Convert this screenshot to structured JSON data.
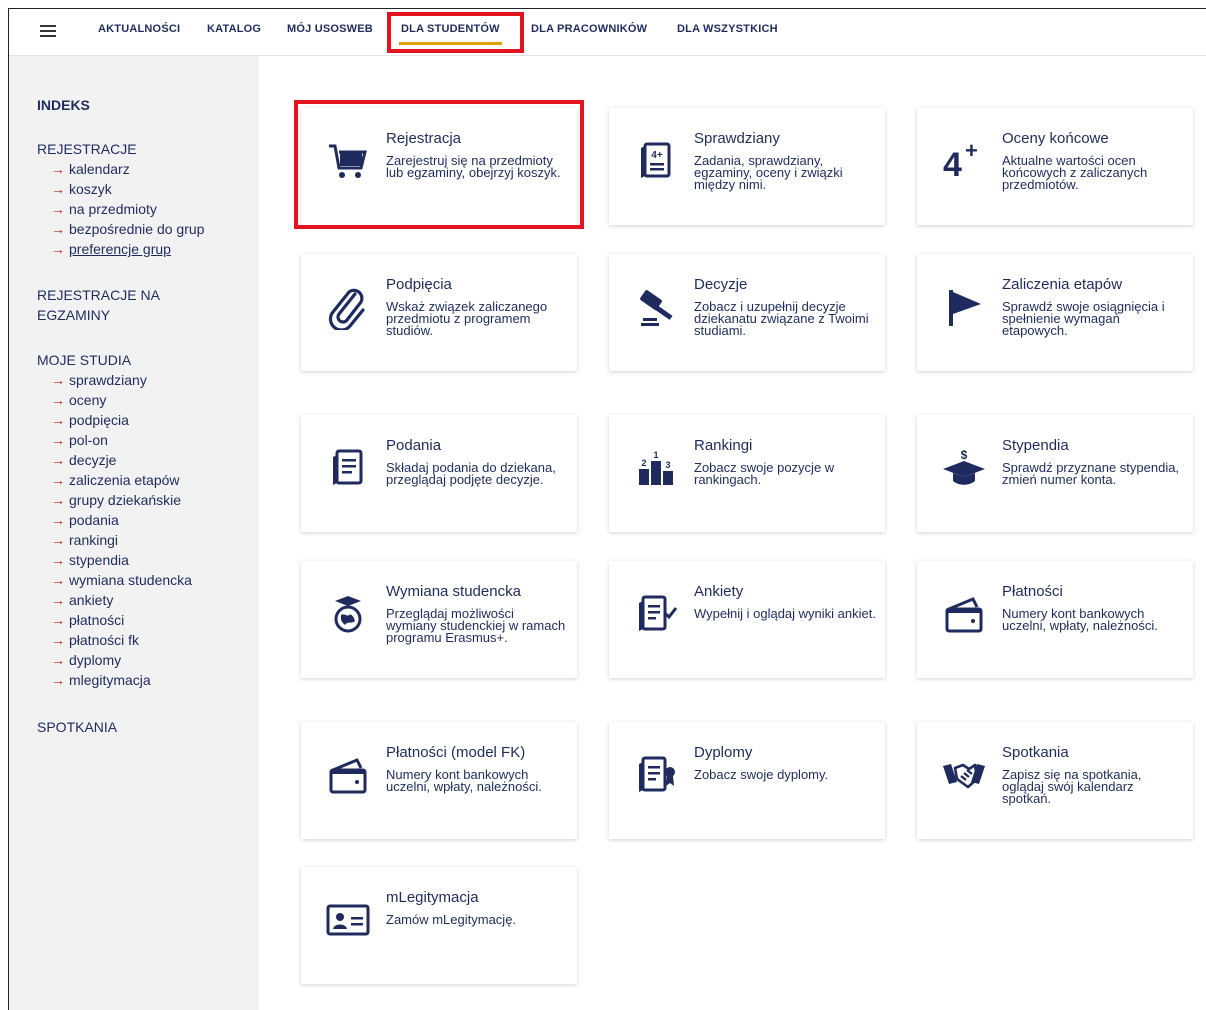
{
  "nav": {
    "items": [
      {
        "label": "AKTUALNOŚCI"
      },
      {
        "label": "KATALOG"
      },
      {
        "label": "MÓJ USOSWEB"
      },
      {
        "label": "DLA STUDENTÓW"
      },
      {
        "label": "DLA PRACOWNIKÓW"
      },
      {
        "label": "DLA WSZYSTKICH"
      }
    ]
  },
  "sidebar": {
    "indeks": "INDEKS",
    "rejestracje": "REJESTRACJE",
    "rejestracje_links": [
      "kalendarz",
      "koszyk",
      "na przedmioty",
      "bezpośrednie do grup",
      "preferencje grup"
    ],
    "rejestracje_na_1": "REJESTRACJE NA",
    "rejestracje_na_2": "EGZAMINY",
    "moje_studia": "MOJE STUDIA",
    "moje_links": [
      "sprawdziany",
      "oceny",
      "podpięcia",
      "pol-on",
      "decyzje",
      "zaliczenia etapów",
      "grupy dziekańskie",
      "podania",
      "rankingi",
      "stypendia",
      "wymiana studencka",
      "ankiety",
      "płatności",
      "płatności fk",
      "dyplomy",
      "mlegitymacja"
    ],
    "spotkania": "SPOTKANIA",
    "arrow": "→"
  },
  "cards": [
    {
      "title": "Rejestracja",
      "desc": "Zarejestruj się na przedmioty lub egzaminy, obejrzyj koszyk.",
      "icon": "cart-icon"
    },
    {
      "title": "Sprawdziany",
      "desc": "Zadania, sprawdziany, egzaminy, oceny i związki między nimi.",
      "icon": "test-paper-icon",
      "icon_text": "4+"
    },
    {
      "title": "Oceny końcowe",
      "desc": "Aktualne wartości ocen końcowych z zaliczanych przedmiotów.",
      "icon": "grade-icon",
      "icon_text": "4+"
    },
    {
      "title": "Podpięcia",
      "desc": "Wskaż związek zaliczanego przedmiotu z programem studiów.",
      "icon": "paperclip-icon"
    },
    {
      "title": "Decyzje",
      "desc": "Zobacz i uzupełnij decyzje dziekanatu związane z Twoimi studiami.",
      "icon": "gavel-icon"
    },
    {
      "title": "Zaliczenia etapów",
      "desc": "Sprawdź swoje osiągnięcia i spełnienie wymagań etapowych.",
      "icon": "flag-icon"
    },
    {
      "title": "Podania",
      "desc": "Składaj podania do dziekana, przeglądaj podjęte decyzje.",
      "icon": "document-icon"
    },
    {
      "title": "Rankingi",
      "desc": "Zobacz swoje pozycje w rankingach.",
      "icon": "podium-icon"
    },
    {
      "title": "Stypendia",
      "desc": "Sprawdź przyznane stypendia, zmień numer konta.",
      "icon": "graduation-cap-icon"
    },
    {
      "title": "Wymiana studencka",
      "desc": "Przeglądaj możliwości wymiany studenckiej w ramach programu Erasmus+.",
      "icon": "globe-cap-icon"
    },
    {
      "title": "Ankiety",
      "desc": "Wypełnij i oglądaj wyniki ankiet.",
      "icon": "survey-icon"
    },
    {
      "title": "Płatności",
      "desc": "Numery kont bankowych uczelni, wpłaty, należności.",
      "icon": "wallet-icon"
    },
    {
      "title": "Płatności (model FK)",
      "desc": "Numery kont bankowych uczelni, wpłaty, należności.",
      "icon": "wallet-icon"
    },
    {
      "title": "Dyplomy",
      "desc": "Zobacz swoje dyplomy.",
      "icon": "diploma-icon"
    },
    {
      "title": "Spotkania",
      "desc": "Zapisz się na spotkania, oglądaj swój kalendarz spotkań.",
      "icon": "handshake-icon"
    },
    {
      "title": "mLegitymacja",
      "desc": "Zamów mLegitymację.",
      "icon": "id-card-icon"
    }
  ]
}
